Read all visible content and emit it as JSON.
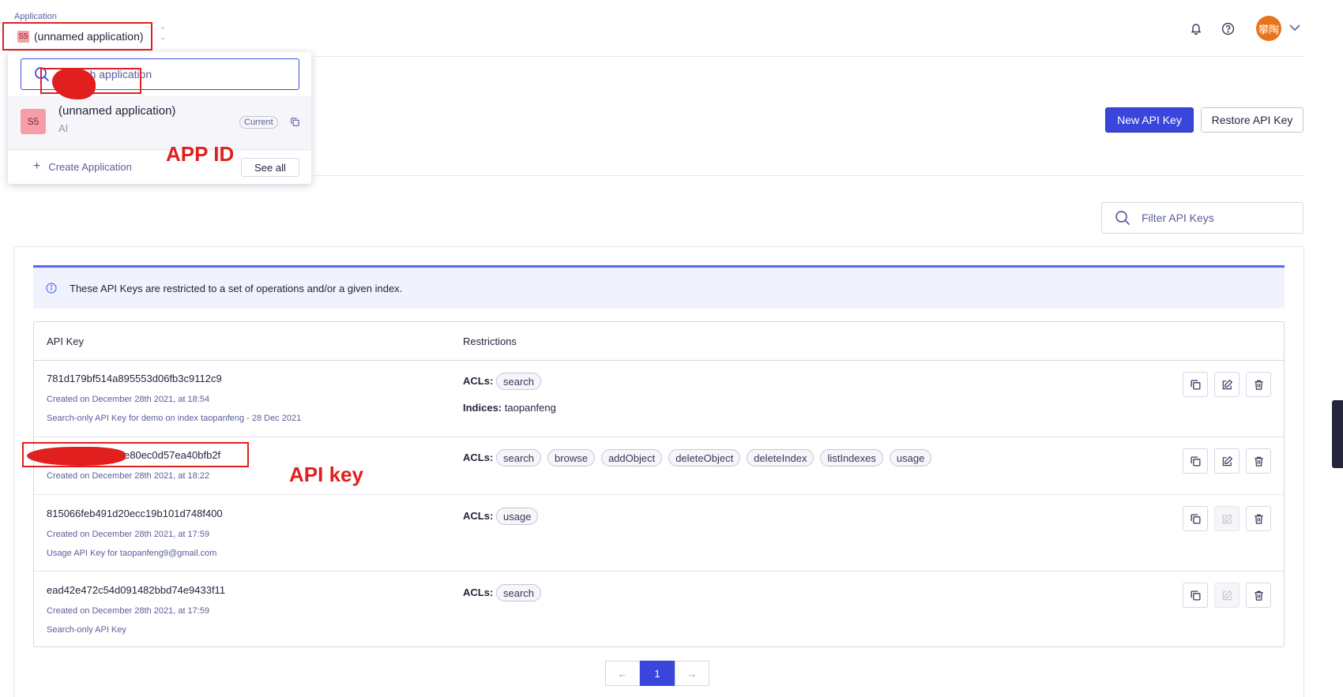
{
  "header": {
    "app_label": "Application",
    "app_badge": "S5",
    "app_name": "(unnamed application)",
    "avatar_text": "攀陶"
  },
  "dropdown": {
    "search_placeholder": "Search application",
    "app": {
      "badge": "S5",
      "name": "(unnamed application)",
      "id_visible": "AI",
      "current_label": "Current"
    },
    "create_label": "Create Application",
    "see_all_label": "See all"
  },
  "annotations": {
    "app_id": "APP ID",
    "api_key": "API key"
  },
  "actions": {
    "new_key_label": "New API Key",
    "restore_key_label": "Restore API Key",
    "filter_placeholder": "Filter API Keys"
  },
  "info_banner": "These API Keys are restricted to a set of operations and/or a given index.",
  "table": {
    "headers": [
      "API Key",
      "Restrictions"
    ],
    "acl_label": "ACLs:",
    "indices_label": "Indices:",
    "rows": [
      {
        "key": "781d179bf514a895553d06fb3c9112c9",
        "created": "Created on December 28th 2021, at 18:54",
        "description": "Search-only API Key for demo on index taopanfeng - 28 Dec 2021",
        "acls": [
          "search"
        ],
        "indices": "taopanfeng",
        "edit_enabled": true
      },
      {
        "key": "e80ec0d57ea40bfb2f",
        "created": "Created on December 28th 2021, at 18:22",
        "description": "",
        "acls": [
          "search",
          "browse",
          "addObject",
          "deleteObject",
          "deleteIndex",
          "listIndexes",
          "usage"
        ],
        "indices": "",
        "edit_enabled": true
      },
      {
        "key": "815066feb491d20ecc19b101d748f400",
        "created": "Created on December 28th 2021, at 17:59",
        "description": "Usage API Key for taopanfeng9@gmail.com",
        "acls": [
          "usage"
        ],
        "indices": "",
        "edit_enabled": false
      },
      {
        "key": "ead42e472c54d091482bbd74e9433f11",
        "created": "Created on December 28th 2021, at 17:59",
        "description": "Search-only API Key",
        "acls": [
          "search"
        ],
        "indices": "",
        "edit_enabled": false
      }
    ]
  },
  "pagination": {
    "prev": "←",
    "current": "1",
    "next": "→"
  },
  "colors": {
    "primary": "#3a46db",
    "annotation": "#e21f1f",
    "app_badge": "#f79da8",
    "avatar": "#e8741c"
  }
}
